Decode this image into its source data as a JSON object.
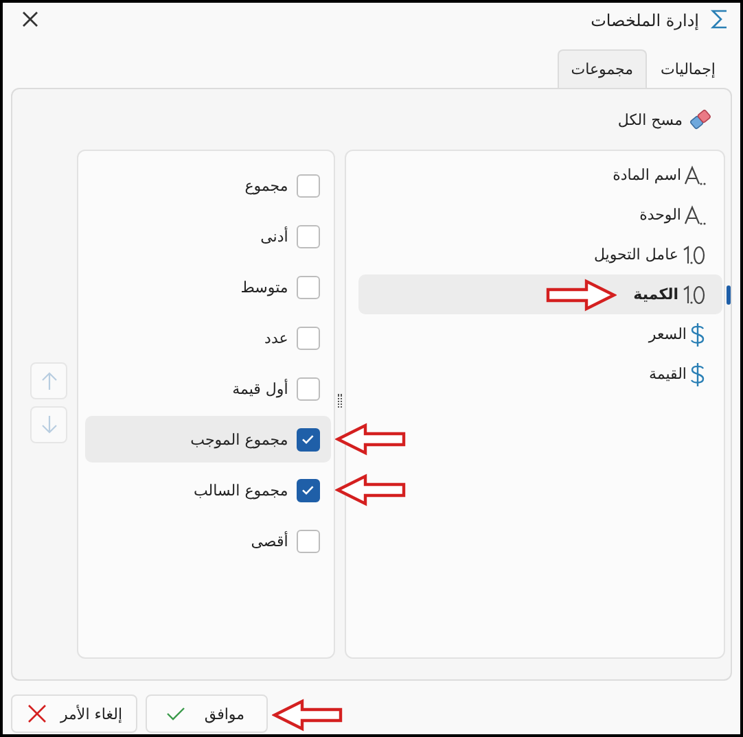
{
  "window": {
    "title": "إدارة الملخصات"
  },
  "tabs": [
    {
      "label": "إجماليات",
      "selected": false
    },
    {
      "label": "مجموعات",
      "selected": true
    }
  ],
  "clear_all": {
    "label": "مسح الكل"
  },
  "fields": [
    {
      "label": "اسم المادة",
      "kind": "text",
      "selected": false
    },
    {
      "label": "الوحدة",
      "kind": "text",
      "selected": false
    },
    {
      "label": "عامل التحويل",
      "kind": "number",
      "selected": false
    },
    {
      "label": "الكمية",
      "kind": "number",
      "selected": true,
      "arrow": true
    },
    {
      "label": "السعر",
      "kind": "currency",
      "selected": false
    },
    {
      "label": "القيمة",
      "kind": "currency",
      "selected": false
    }
  ],
  "aggregates": [
    {
      "label": "مجموع",
      "checked": false,
      "selected": false
    },
    {
      "label": "أدنى",
      "checked": false,
      "selected": false
    },
    {
      "label": "متوسط",
      "checked": false,
      "selected": false
    },
    {
      "label": "عدد",
      "checked": false,
      "selected": false
    },
    {
      "label": "أول قيمة",
      "checked": false,
      "selected": false
    },
    {
      "label": "مجموع الموجب",
      "checked": true,
      "selected": true,
      "arrow": true
    },
    {
      "label": "مجموع السالب",
      "checked": true,
      "selected": false,
      "arrow": true
    },
    {
      "label": "أقصى",
      "checked": false,
      "selected": false
    }
  ],
  "move_buttons": [
    {
      "kind": "up",
      "disabled": true
    },
    {
      "kind": "down",
      "disabled": true
    }
  ],
  "buttons": [
    {
      "label": "موافق",
      "kind": "ok",
      "arrow": true
    },
    {
      "label": "إلغاء الأمر",
      "kind": "cancel"
    }
  ]
}
